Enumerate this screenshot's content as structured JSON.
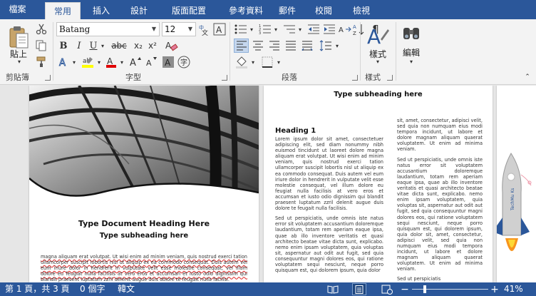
{
  "tabs": {
    "file": "檔案",
    "home": "常用",
    "insert": "插入",
    "design": "設計",
    "layout": "版面配置",
    "references": "參考資料",
    "mailings": "郵件",
    "review": "校閱",
    "view": "檢視"
  },
  "clipboard": {
    "paste_label": "貼上",
    "group_label": "剪貼簿"
  },
  "font": {
    "name": "Batang",
    "size": "12",
    "group_label": "字型",
    "bold": "B",
    "italic": "I",
    "underline": "U",
    "strike": "abc",
    "subscript": "x₂",
    "superscript": "x²"
  },
  "paragraph": {
    "group_label": "段落"
  },
  "styles": {
    "button_label": "樣式",
    "group_label": "樣式"
  },
  "editing": {
    "button_label": "編輯"
  },
  "document": {
    "page1": {
      "heading": "Type Document Heading Here",
      "subheading": "Type subheading here",
      "body": "magna aliquam erat volutpat. Ut wisi enim ad minim veniam, quis nostrud exerci tation ullamcorper suscipit lobortis nisl ut aliquip ex ea commodo consequat. Duis autem vel eum iriure dolor in hendrerit in vulputate velit esse molestie consequat, vel illum dolore eu feugiat nulla facilisis at vero eros et accumsan et iusto odio dignissim qui blandit praesent luptatum zzril delenit augue duis dolore te feugait nulla facilisi."
    },
    "page2": {
      "subheading": "Type subheading here",
      "heading1": "Heading 1",
      "col1_p1": "Lorem ipsum dolor sit amet, consectetuer adipiscing elit, sed diam nonummy nibh euismod tincidunt ut laoreet dolore magna aliquam erat volutpat. Ut wisi enim ad minim veniam, quis nostrud exerci tation ullamcorper suscipit lobortis nisl ut aliquip ex ea commodo consequat. Duis autem vel eum iriure dolor in hendrerit in vulputate velit esse molestie consequat, vel illum dolore eu feugiat nulla facilisis at vero eros et accumsan et iusto odio dignissim qui blandit praesent luptatum zzril delenit augue duis dolore te feugait nulla facilisis.",
      "col1_p2": "Sed ut perspiciatis, unde omnis iste natus error sit voluptatem accusantium doloremque laudantium, totam rem aperiam eaque ipsa, quae ab illo inventore veritatis et quasi architecto beatae vitae dicta sunt, explicabo. nemo enim ipsam voluptatem, quia voluptas sit, aspernatur aut odit aut fugit, sed quia consequuntur magni dolores eos, qui ratione voluptatem sequi nesciunt, neque porro quisquam est, qui dolorem ipsum, quia dolor",
      "col2_p1": "sit, amet, consectetur, adipisci velit, sed quia non numquam eius modi tempora incidunt, ut labore et dolore magnam aliquam quaerat voluptatem. Ut enim ad minima veniam.",
      "col2_p2": "Sed ut perspiciatis, unde omnis iste natus error sit voluptatem accusantium doloremque laudantium, totam rem aperiam eaque ipsa, quae ab illo inventore veritatis et quasi architecto beatae vitae dicta sunt, explicabo. nemo enim ipsam voluptatem, quia voluptas sit, aspernatur aut odit aut fugit, sed quia consequuntur magni dolores eos, qui ratione voluptatem sequi nesciunt, neque porro quisquam est, qui dolorem ipsum, quia dolor sit, amet, consectetur, adipisci velit, sed quia non numquam eius modi tempora incidunt, ut labore et dolore magnam aliquam quaerat voluptatem. Ut enim ad minima veniam.",
      "col2_p3": "Sed ut perspiciatis"
    },
    "page3": {
      "rocket_text": "TechMu Ks"
    }
  },
  "status": {
    "page": "第 1 頁，共 3 頁",
    "words": "0 個字",
    "language": "韓文",
    "zoom": "41%",
    "zoom_level": 0.41
  },
  "colors": {
    "accent": "#2b579a",
    "highlight": "#ffff00",
    "font_color": "#e00000"
  }
}
